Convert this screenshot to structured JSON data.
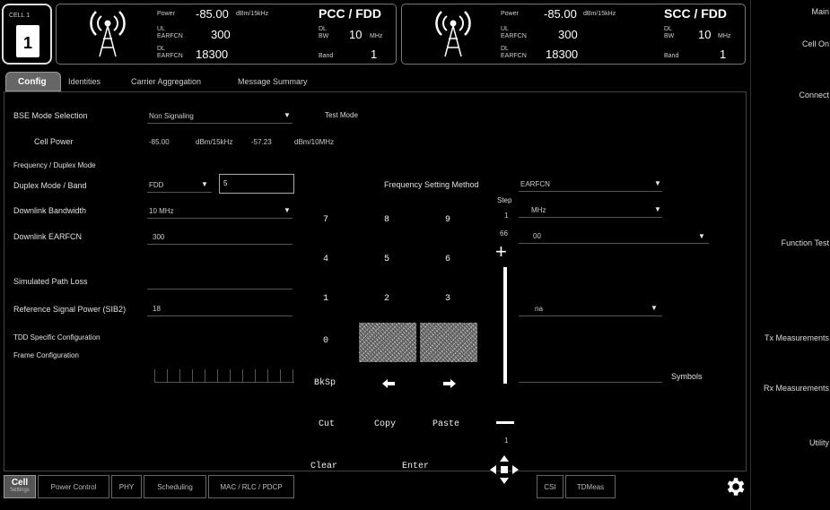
{
  "cell_button": {
    "label": "1",
    "caption": "CELL 1"
  },
  "pcc": {
    "power_label": "Power",
    "power_value": "-85.00",
    "power_unit": "dBm/15kHz",
    "ul_label": "UL",
    "earfcn_label": "EARFCN",
    "ul_earfcn": "300",
    "dl_label": "DL",
    "dl_earfcn": "18300",
    "title": "PCC / FDD",
    "bw_label": "BW",
    "bw_value": "10",
    "bw_unit": "MHz",
    "band_label": "Band",
    "band_value": "1"
  },
  "scc": {
    "power_label": "Power",
    "power_value": "-85.00",
    "power_unit": "dBm/15kHz",
    "ul_label": "UL",
    "earfcn_label": "EARFCN",
    "ul_earfcn": "300",
    "dl_label": "DL",
    "dl_earfcn": "18300",
    "title": "SCC / FDD",
    "bw_label": "BW",
    "bw_value": "10",
    "bw_unit": "MHz",
    "band_label": "Band",
    "band_value": "1"
  },
  "tabs": [
    "Config",
    "Identities",
    "Carrier Aggregation",
    "Message Summary"
  ],
  "sidebar": [
    "Main",
    "Cell On",
    "Connect",
    "Function Test",
    "Tx Measurements",
    "Rx Measurements",
    "Utility"
  ],
  "config": {
    "bse_mode_label": "BSE Mode Selection",
    "bse_mode_value": "Non Signaling",
    "test_mode_label": "Test Mode",
    "cell_power_label": "Cell Power",
    "cell_power_value": "-85.00",
    "cell_power_unit": "dBm/15kHz",
    "cell_power_value2": "-57.23",
    "cell_power_unit2": "dBm/10MHz",
    "freq_section": "Frequency / Duplex Mode",
    "duplex_label": "Duplex Mode / Band",
    "duplex_value": "FDD",
    "band_input": "5",
    "freq_method_label": "Frequency Setting Method",
    "freq_method_value": "EARFCN",
    "dl_bw_label": "Downlink Bandwidth",
    "dl_bw_value": "10 MHz",
    "unit_mhz": "MHz",
    "dl_earfcn_label": "Downlink EARFCN",
    "dl_earfcn_value": "300",
    "dl_earfcn_value2": "00",
    "path_loss_label": "Simulated Path Loss",
    "ref_power_label": "Reference Signal Power (SIB2)",
    "ref_power_value": "18",
    "ref_power_unit": "na",
    "tdd_label": "TDD Specific Configuration",
    "frame_label": "Frame Configuration",
    "symbols_label": "Symbols"
  },
  "keypad": {
    "digits": [
      "7",
      "8",
      "9",
      "4",
      "5",
      "6",
      "1",
      "2",
      "3",
      "0"
    ],
    "backspace": "BkSp",
    "cut": "Cut",
    "copy": "Copy",
    "paste": "Paste",
    "clear": "Clear",
    "enter": "Enter",
    "step_label": "Step",
    "step_top": "1",
    "step_mid": "66",
    "step_bottom": "1"
  },
  "bottom_tabs": [
    "Cell",
    "Power Control",
    "PHY",
    "Scheduling",
    "MAC / RLC / PDCP",
    "CSI",
    "TDMeas"
  ],
  "bottom_tab_caption": "Settings",
  "icons": [
    "antenna-icon",
    "gear-icon",
    "arrow-left-icon",
    "arrow-right-icon",
    "move-icon",
    "plus-icon",
    "minus-icon"
  ]
}
